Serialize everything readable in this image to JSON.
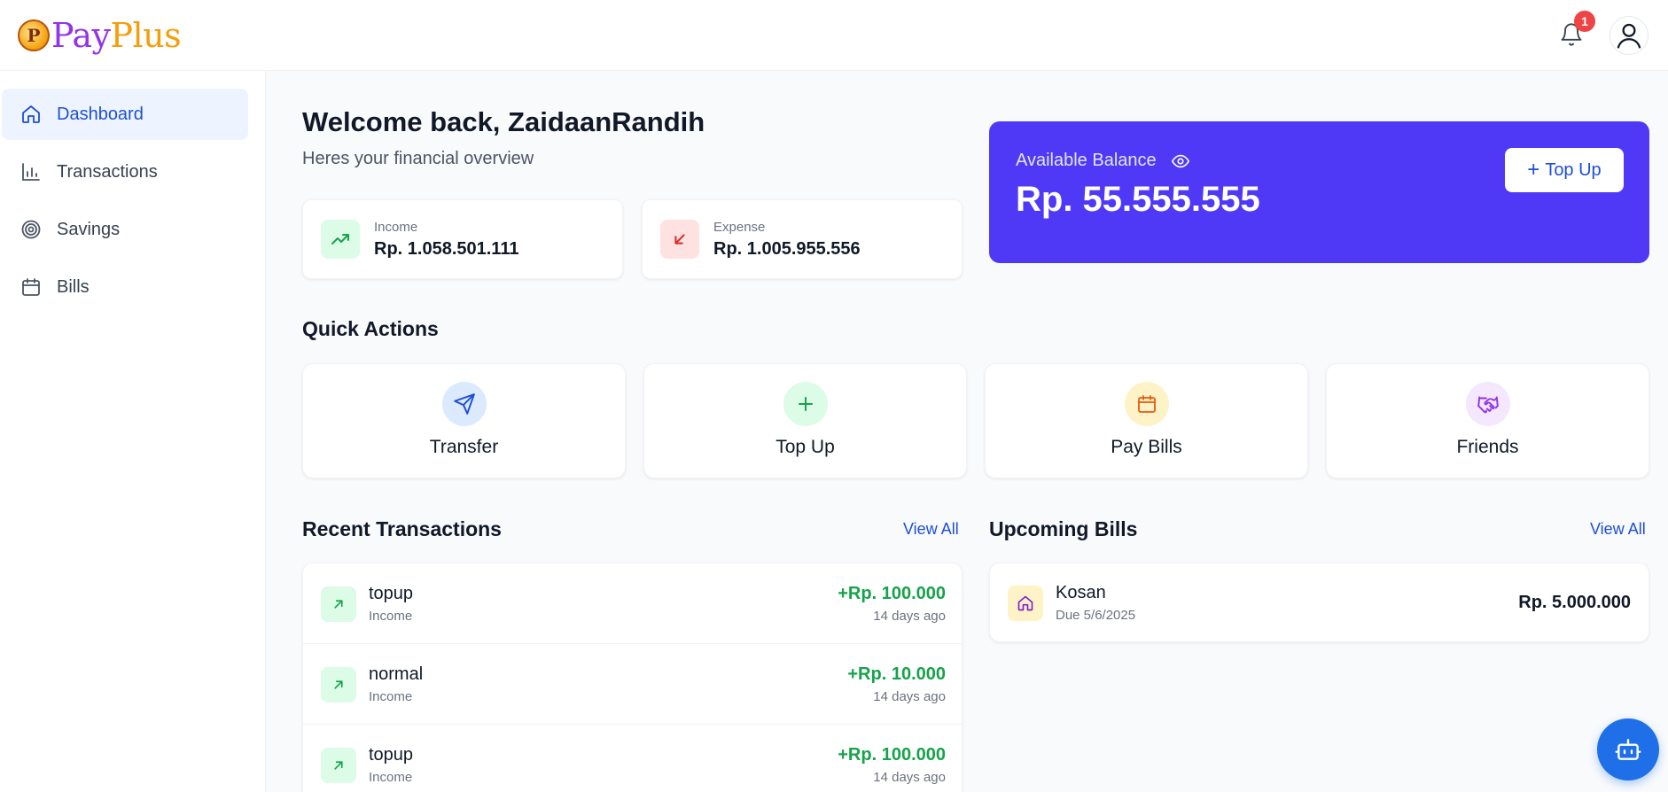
{
  "app": {
    "logo_letter": "P",
    "logo_pay": "Pay",
    "logo_plus": "Plus",
    "notification_count": "1"
  },
  "sidebar": {
    "items": [
      {
        "label": "Dashboard",
        "icon": "home-icon",
        "active": true
      },
      {
        "label": "Transactions",
        "icon": "bar-chart-icon",
        "active": false
      },
      {
        "label": "Savings",
        "icon": "target-icon",
        "active": false
      },
      {
        "label": "Bills",
        "icon": "calendar-icon",
        "active": false
      }
    ]
  },
  "welcome": {
    "title": "Welcome back, ZaidaanRandih",
    "subtitle": "Heres your financial overview"
  },
  "stats": {
    "income": {
      "label": "Income",
      "value": "Rp. 1.058.501.111",
      "color": "#16a34a"
    },
    "expense": {
      "label": "Expense",
      "value": "Rp. 1.005.955.556",
      "color": "#dc2626"
    }
  },
  "balance": {
    "label": "Available Balance",
    "value": "Rp. 55.555.555",
    "topup_label": "Top Up",
    "color": "#4f39f6"
  },
  "quick_actions": {
    "title": "Quick Actions",
    "items": [
      {
        "label": "Transfer",
        "icon": "send-icon"
      },
      {
        "label": "Top Up",
        "icon": "plus-icon"
      },
      {
        "label": "Pay Bills",
        "icon": "calendar-icon"
      },
      {
        "label": "Friends",
        "icon": "handshake-icon"
      }
    ]
  },
  "recent_transactions": {
    "title": "Recent Transactions",
    "view_all": "View All",
    "items": [
      {
        "name": "topup",
        "type": "Income",
        "amount": "+Rp. 100.000",
        "time": "14 days ago"
      },
      {
        "name": "normal",
        "type": "Income",
        "amount": "+Rp. 10.000",
        "time": "14 days ago"
      },
      {
        "name": "topup",
        "type": "Income",
        "amount": "+Rp. 100.000",
        "time": "14 days ago"
      }
    ]
  },
  "upcoming_bills": {
    "title": "Upcoming Bills",
    "view_all": "View All",
    "items": [
      {
        "name": "Kosan",
        "due": "Due 5/6/2025",
        "amount": "Rp. 5.000.000"
      }
    ]
  },
  "chatbot": {
    "icon": "bot-icon"
  }
}
